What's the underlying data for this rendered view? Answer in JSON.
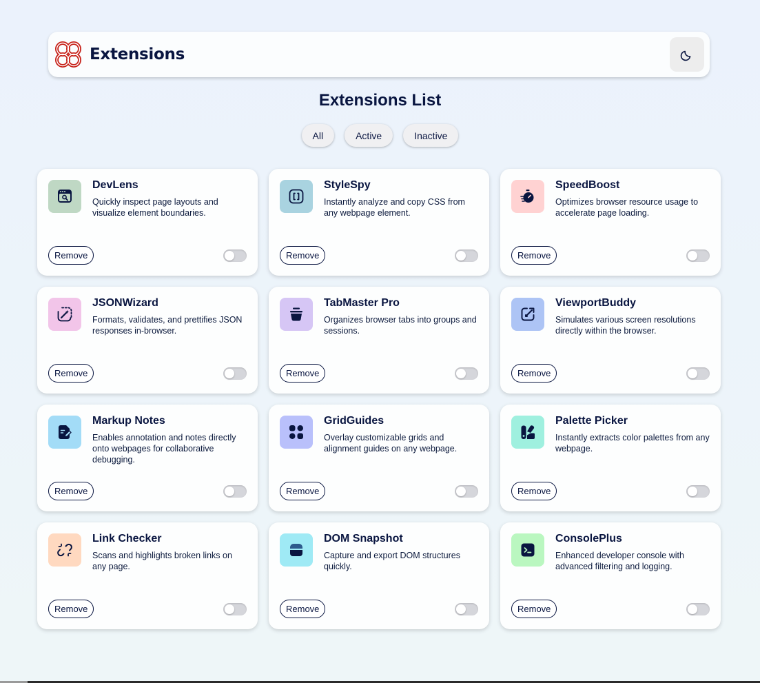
{
  "header": {
    "app_name": "Extensions",
    "logo_colors": [
      "#c7221a"
    ],
    "theme_toggle_icon": "moon-icon"
  },
  "page": {
    "title": "Extensions List"
  },
  "filters": [
    {
      "label": "All"
    },
    {
      "label": "Active"
    },
    {
      "label": "Inactive"
    }
  ],
  "extensions": [
    {
      "name": "DevLens",
      "description": "Quickly inspect page layouts and visualize element boundaries.",
      "icon": "browser-search-icon",
      "icon_bg": "#bfd8c4",
      "remove_label": "Remove",
      "active": false
    },
    {
      "name": "StyleSpy",
      "description": "Instantly analyze and copy CSS from any webpage element.",
      "icon": "brackets-icon",
      "icon_bg": "#a9d3e0",
      "remove_label": "Remove",
      "active": false
    },
    {
      "name": "SpeedBoost",
      "description": "Optimizes browser resource usage to accelerate page loading.",
      "icon": "stopwatch-icon",
      "icon_bg": "#ffd2d2",
      "remove_label": "Remove",
      "active": false
    },
    {
      "name": "JSONWizard",
      "description": "Formats, validates, and prettifies JSON responses in-browser.",
      "icon": "wand-icon",
      "icon_bg": "#f2c5e9",
      "remove_label": "Remove",
      "active": false
    },
    {
      "name": "TabMaster Pro",
      "description": "Organizes browser tabs into groups and sessions.",
      "icon": "basket-icon",
      "icon_bg": "#d6c6f5",
      "remove_label": "Remove",
      "active": false
    },
    {
      "name": "ViewportBuddy",
      "description": "Simulates various screen resolutions directly within the browser.",
      "icon": "resize-arrow-icon",
      "icon_bg": "#adc4f5",
      "remove_label": "Remove",
      "active": false
    },
    {
      "name": "Markup Notes",
      "description": "Enables annotation and notes directly onto webpages for collaborative debugging.",
      "icon": "note-pencil-icon",
      "icon_bg": "#a3dcf7",
      "remove_label": "Remove",
      "active": false
    },
    {
      "name": "GridGuides",
      "description": "Overlay customizable grids and alignment guides on any webpage.",
      "icon": "grid-icon",
      "icon_bg": "#b9c0fb",
      "remove_label": "Remove",
      "active": false
    },
    {
      "name": "Palette Picker",
      "description": "Instantly extracts color palettes from any webpage.",
      "icon": "palette-icon",
      "icon_bg": "#9ff0df",
      "remove_label": "Remove",
      "active": false
    },
    {
      "name": "Link Checker",
      "description": "Scans and highlights broken links on any page.",
      "icon": "broken-link-icon",
      "icon_bg": "#ffd9c0",
      "remove_label": "Remove",
      "active": false
    },
    {
      "name": "DOM Snapshot",
      "description": "Capture and export DOM structures quickly.",
      "icon": "snapshot-icon",
      "icon_bg": "#9feaf5",
      "remove_label": "Remove",
      "active": false
    },
    {
      "name": "ConsolePlus",
      "description": "Enhanced developer console with advanced filtering and logging.",
      "icon": "terminal-icon",
      "icon_bg": "#baf7c0",
      "remove_label": "Remove",
      "active": false
    }
  ]
}
